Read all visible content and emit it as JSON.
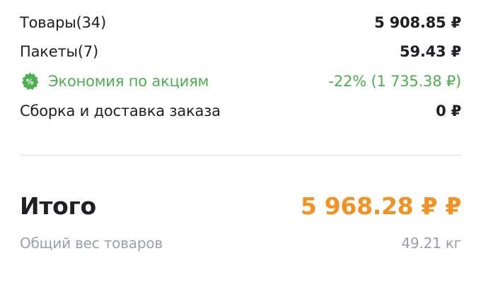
{
  "order_summary": {
    "items": {
      "label": "Товары",
      "count": "(34)",
      "amount": "5 908.85 ₽"
    },
    "bags": {
      "label": "Пакеты",
      "count": "(7)",
      "amount": "59.43 ₽"
    },
    "discount": {
      "badge_icon": "percent-badge-icon",
      "badge_symbol": "%",
      "label": "Экономия по акциям",
      "amount": "-22% (1 735.38 ₽)",
      "color": "#4caf4f"
    },
    "delivery": {
      "label": "Сборка и доставка заказа",
      "amount": "0 ₽"
    },
    "total": {
      "label": "Итого",
      "amount": "5 968.28 ₽ ₽",
      "color": "#f39222"
    },
    "weight": {
      "label": "Общий вес товаров",
      "amount": "49.21 кг"
    }
  }
}
